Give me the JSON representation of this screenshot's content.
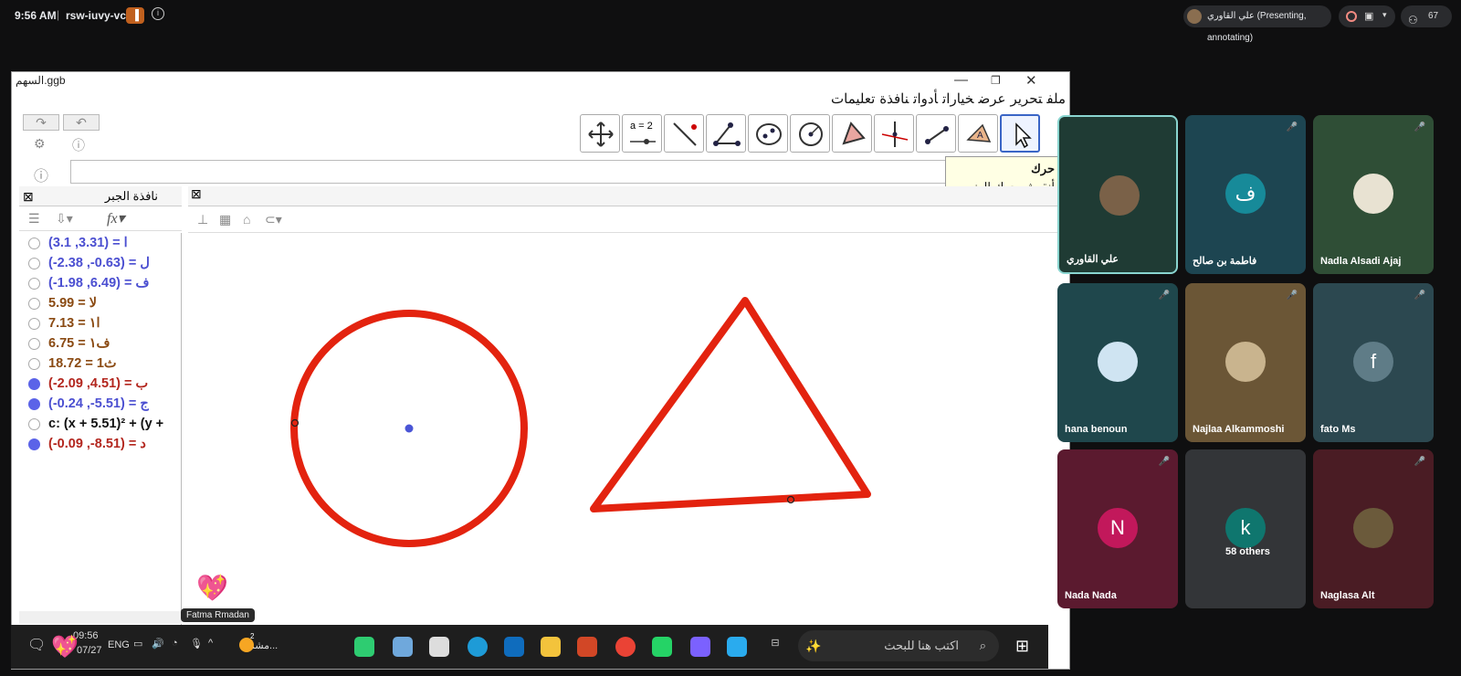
{
  "topbar": {
    "time": "9:56 AM",
    "separator": "|",
    "meeting_code": "rsw-iuvy-vcg",
    "badge": "",
    "presenter": "علي القاوري (Presenting, annotating)",
    "participant_count": "67"
  },
  "ggb": {
    "title": "السهم.ggb",
    "window_controls": {
      "minimize": "—",
      "restore": "❐",
      "close": "✕"
    },
    "menu": [
      "ملف",
      "تحرير",
      "عرض",
      "خيارات",
      "أدوات",
      "نافذة",
      "تعليمات"
    ],
    "tooltip": {
      "title": "حرك",
      "body": "أنقر ثم حرك العنصر"
    },
    "toolbar_text": "a = 2",
    "algebra_title": "نافذة الجبر",
    "algebra_rows": [
      {
        "text": "(3.1 ,3.31) = ا",
        "color": "#4b4fd1",
        "dot": false
      },
      {
        "text": "(-2.38 ,-0.63) = ل",
        "color": "#4b4fd1",
        "dot": false
      },
      {
        "text": "(-1.98 ,6.49) = ف",
        "color": "#4b4fd1",
        "dot": false
      },
      {
        "text": "5.99 = لا",
        "color": "#8a4a12",
        "dot": false
      },
      {
        "text": "7.13 = ا١",
        "color": "#8a4a12",
        "dot": false
      },
      {
        "text": "6.75 = ف١",
        "color": "#8a4a12",
        "dot": false
      },
      {
        "text": "18.72 = ث1",
        "color": "#8a4a12",
        "dot": false
      },
      {
        "text": "(-2.09 ,4.51) = ب",
        "color": "#b3261e",
        "dot": true
      },
      {
        "text": "(-0.24 ,-5.51) = ج",
        "color": "#4b4fd1",
        "dot": true
      },
      {
        "text": "c: (x + 5.51)² + (y +",
        "color": "#111111",
        "dot": false
      },
      {
        "text": "(-0.09 ,-8.51) = د",
        "color": "#b3261e",
        "dot": true
      }
    ],
    "shape_color": "#e3230f",
    "point_color": "#4a55d6"
  },
  "annotation": {
    "name": "Fatma Rmadan",
    "emoji": "💖"
  },
  "taskbar": {
    "clock": "09:56",
    "date": "07/27",
    "lang": "ENG",
    "app_label": "مشم...",
    "search_placeholder": "اكتب هنا للبحث",
    "notif": "2"
  },
  "tiles": [
    {
      "name": "علي القاوري",
      "initial": "",
      "color": "#1f3b34",
      "av_color": "#7a6148",
      "muted": false
    },
    {
      "name": "فاطمة بن صالح",
      "initial": "ف",
      "color": "#1d4551",
      "av_color": "#178a99",
      "muted": true
    },
    {
      "name": "Nadla Alsadi Ajaj",
      "initial": "",
      "color": "#2f4e36",
      "av_color": "#e8e2d2",
      "muted": true
    },
    {
      "name": "hana benoun",
      "initial": "",
      "color": "#1f474c",
      "av_color": "#cfe4f2",
      "muted": true
    },
    {
      "name": "Najlaa Alkammoshi",
      "initial": "",
      "color": "#6b5636",
      "av_color": "#c9b48e",
      "muted": true
    },
    {
      "name": "fato Ms",
      "initial": "f",
      "color": "#2c4850",
      "av_color": "#5f7c87",
      "muted": true
    },
    {
      "name": "Nada Nada",
      "initial": "N",
      "color": "#5b1a2f",
      "av_color": "#c2185b",
      "muted": true
    },
    {
      "name": "58 others",
      "initial": "k",
      "color": "#333538",
      "av_color": "#0f766e",
      "muted": false
    },
    {
      "name": "Naglasa Alt",
      "initial": "",
      "color": "#4a1c24",
      "av_color": "#6b5a3b",
      "muted": true
    }
  ]
}
